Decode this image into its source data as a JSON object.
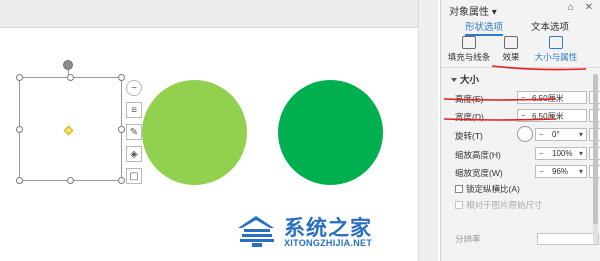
{
  "panel": {
    "title": "对象属性 ▾",
    "header_icons": "⌂ ✕",
    "tabs": [
      "形状选项",
      "文本选项"
    ],
    "subtabs": [
      "填充与线条",
      "效果",
      "大小与属性"
    ],
    "section_title": "大小",
    "height_label": "高度(E)",
    "height_value": "6.50厘米",
    "width_label": "宽度(D)",
    "width_value": "6.50厘米",
    "rotate_label": "旋转(T)",
    "rotate_value": "0°",
    "scale_h_label": "缩放高度(H)",
    "scale_h_value": "100%",
    "scale_w_label": "缩放宽度(W)",
    "scale_w_value": "96%",
    "lock_ratio_label": "锁定纵横比(A)",
    "relative_label": "相对于图片原始尺寸",
    "bottom_label": "分辨率",
    "minus": "−",
    "plus": "+",
    "spin": "▾"
  },
  "canvas": {
    "circle1_color": "#92d050",
    "circle2_color": "#00b050"
  },
  "watermark": {
    "title": "系统之家",
    "url": "XITONGZHIJIA.NET"
  },
  "icons": {
    "collapse": "−",
    "layers": "≡",
    "pen": "✎",
    "fill": "◈",
    "frame": "▢"
  }
}
